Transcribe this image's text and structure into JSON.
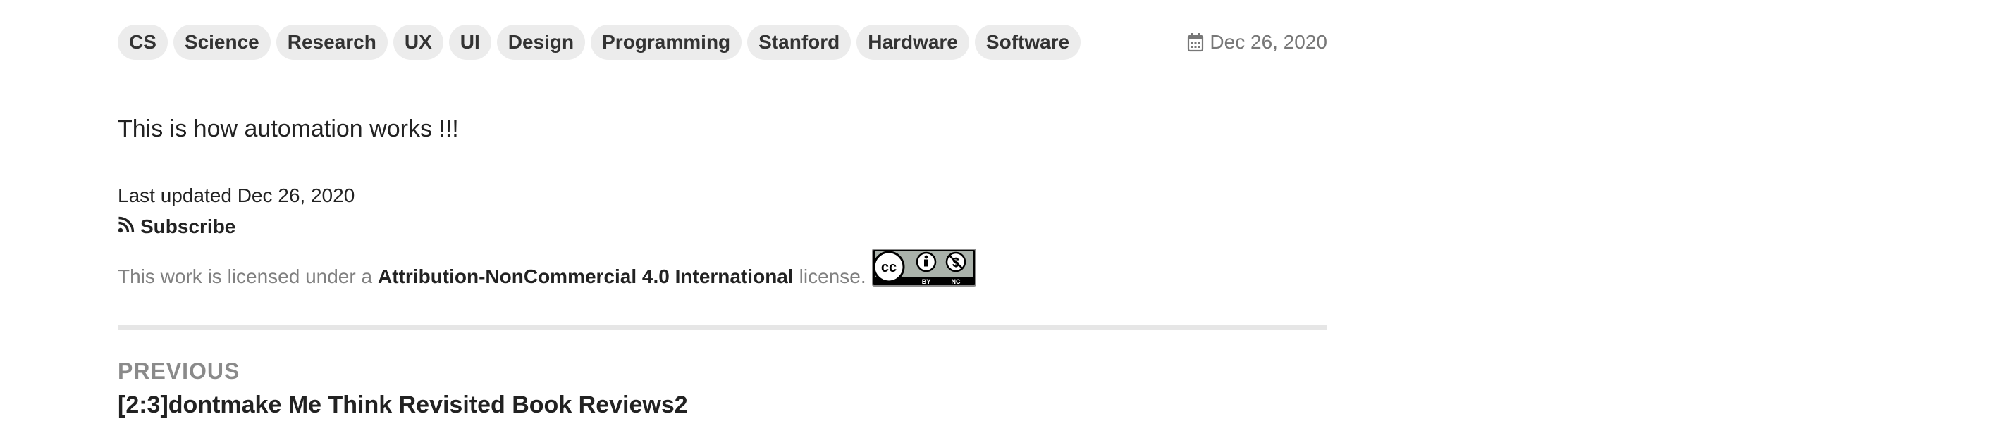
{
  "tags": [
    "CS",
    "Science",
    "Research",
    "UX",
    "UI",
    "Design",
    "Programming",
    "Stanford",
    "Hardware",
    "Software"
  ],
  "post": {
    "date": "Dec 26, 2020",
    "date_icon": "calendar-icon",
    "body": "This is how automation works !!!",
    "last_updated": "Last updated Dec 26, 2020"
  },
  "subscribe": {
    "icon": "rss-icon",
    "label": "Subscribe"
  },
  "license": {
    "prefix": "This work is licensed under a",
    "name": "Attribution-NonCommercial 4.0 International",
    "suffix": "license.",
    "badge_icon": "cc-by-nc-badge",
    "badge_text": [
      "BY",
      "NC"
    ]
  },
  "navigation": {
    "previous_label": "PREVIOUS",
    "previous_title": "[2:3]dontmake Me Think Revisited Book Reviews2"
  }
}
